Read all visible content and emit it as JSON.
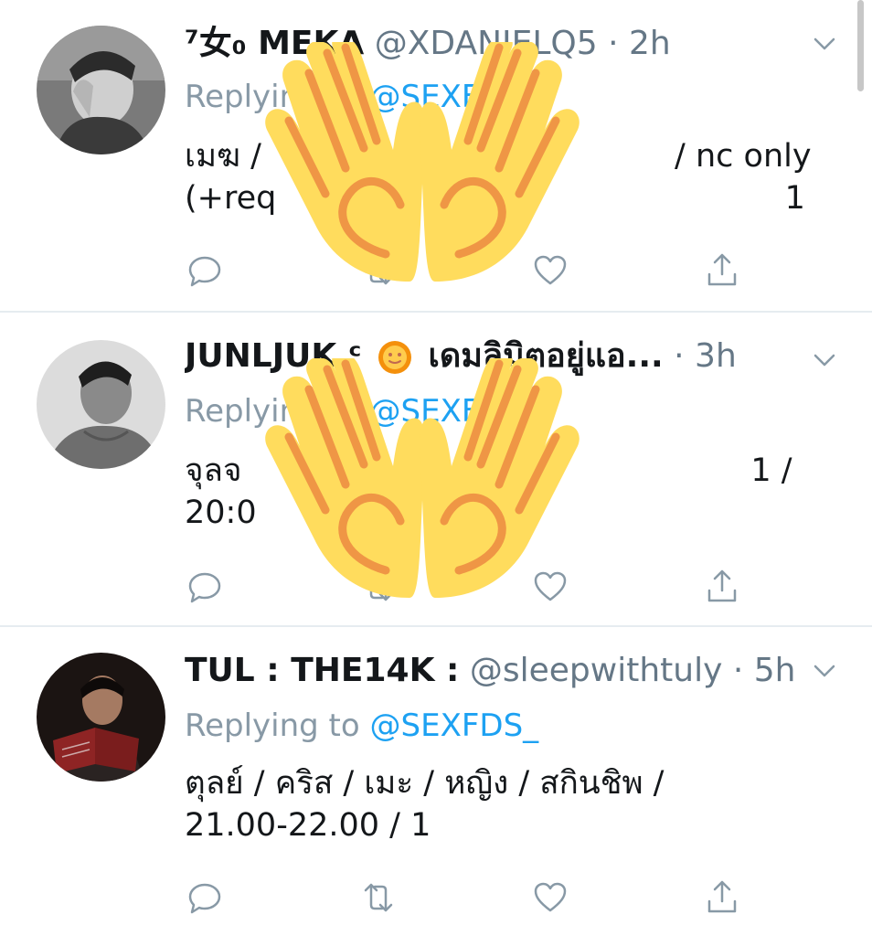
{
  "tweets": [
    {
      "name": "⁷女₀ MEKA",
      "handle": "@XDANIELQ5",
      "time": "2h",
      "reply_prefix": "Replying to",
      "reply_to": "@SEXFDS_",
      "line1": "เมฆ /                s                       / nc only",
      "line2": "(+req                                                  1"
    },
    {
      "name": "JUNLJUK ᶜ",
      "name_suffix": "เดมลิมิตอยู่แอ...",
      "time": "3h",
      "reply_prefix": "Replying to",
      "reply_to": "@SEXFDS_",
      "line1": "จุลจ                   /                              1 /",
      "line2": "20:0"
    },
    {
      "name": "TUL : THE14K :",
      "handle": "@sleepwithtuly",
      "time": "5h",
      "reply_prefix": "Replying to",
      "reply_to": "@SEXFDS_",
      "line1": "ตุลย์ / คริส / เมะ / หญิง / สกินชิพ /",
      "line2": "21.00-22.00 / 1"
    }
  ],
  "icons": {
    "reply": "reply-icon",
    "retweet": "retweet-icon",
    "like": "heart-icon",
    "share": "share-icon",
    "menu": "chevron-down-icon",
    "overlay": "raising-hands-emoji",
    "name_emoji": "sun-with-face-emoji"
  },
  "colors": {
    "text": "#14171a",
    "secondary": "#657786",
    "link": "#1da1f2",
    "divider": "#e6ecf0",
    "emoji_yellow": "#FFDC5D",
    "emoji_orange": "#EF9645"
  }
}
